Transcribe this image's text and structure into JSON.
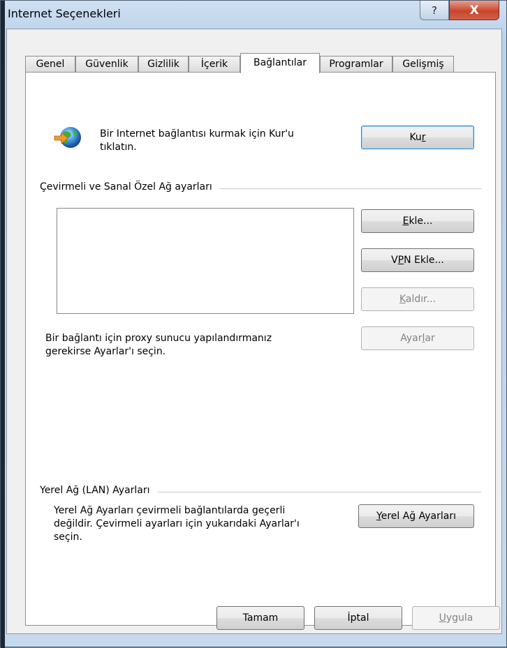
{
  "window": {
    "title": "Internet Seçenekleri",
    "help_glyph": "?",
    "close_glyph": "X"
  },
  "tabs": [
    {
      "label": "Genel"
    },
    {
      "label": "Güvenlik"
    },
    {
      "label": "Gizlilik"
    },
    {
      "label": "İçerik"
    },
    {
      "label": "Bağlantılar",
      "active": true
    },
    {
      "label": "Programlar"
    },
    {
      "label": "Gelişmiş"
    }
  ],
  "setup": {
    "icon": "globe-network-icon",
    "text_line1": "Bir Internet bağlantısı kurmak için Kur'u",
    "text_line2": "tıklatın.",
    "button_prefix": "Ku",
    "button_accel": "r"
  },
  "dialup": {
    "group_label": "Çevirmeli ve Sanal Özel Ağ ayarları",
    "add_accel": "E",
    "add_rest": "kle...",
    "vpn_prefix": "V",
    "vpn_accel": "P",
    "vpn_rest": "N Ekle...",
    "remove_accel": "K",
    "remove_rest": "aldır...",
    "settings_prefix": "Ayar",
    "settings_accel": "l",
    "settings_rest": "ar",
    "proxy_line1": "Bir bağlantı için proxy sunucu yapılandırmanız",
    "proxy_line2": "gerekirse Ayarlar'ı seçin."
  },
  "lan": {
    "group_label": "Yerel Ağ (LAN) Ayarları",
    "desc_line1": "Yerel Ağ Ayarları çevirmeli bağlantılarda geçerli",
    "desc_line2": "değildir. Çevirmeli ayarları için yukarıdaki Ayarlar'ı",
    "desc_line3": "seçin.",
    "button_accel": "Y",
    "button_rest": "erel Ağ Ayarları"
  },
  "footer": {
    "ok_label": "Tamam",
    "cancel_label": "İptal",
    "apply_accel": "U",
    "apply_rest": "ygula"
  },
  "colors": {
    "accent_close": "#c8452c",
    "default_button_border": "#3c7fb1",
    "tab_active_bg": "#ffffff"
  }
}
